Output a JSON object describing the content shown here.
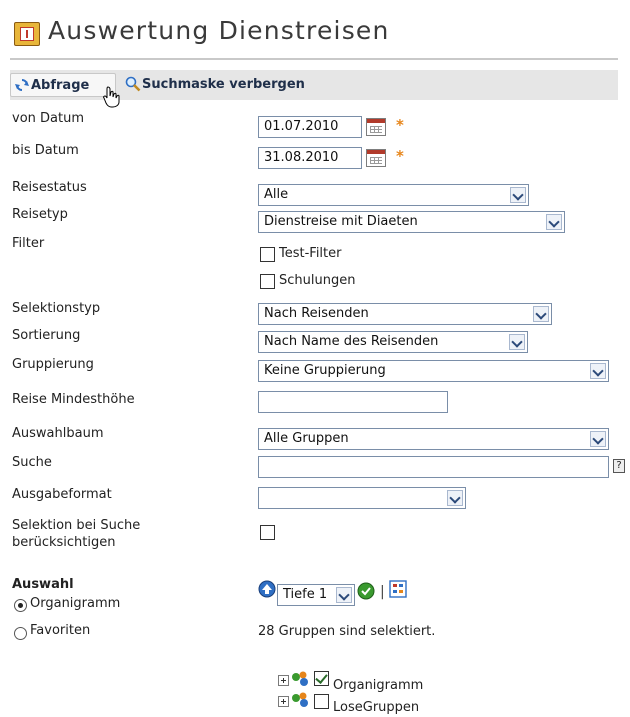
{
  "page": {
    "title": "Auswertung Dienstreisen"
  },
  "toolbar": {
    "query_label": "Abfrage",
    "hide_mask_label": "Suchmaske verbergen"
  },
  "form": {
    "from_date": {
      "label": "von Datum",
      "value": "01.07.2010"
    },
    "to_date": {
      "label": "bis Datum",
      "value": "31.08.2010"
    },
    "required_marker": "*",
    "travel_status": {
      "label": "Reisestatus",
      "value": "Alle"
    },
    "travel_type": {
      "label": "Reisetyp",
      "value": "Dienstreise mit Diaeten"
    },
    "filter": {
      "label": "Filter",
      "options": [
        {
          "label": "Test-Filter",
          "checked": false
        },
        {
          "label": "Schulungen",
          "checked": false
        }
      ]
    },
    "selection_type": {
      "label": "Selektionstyp",
      "value": "Nach Reisenden"
    },
    "sorting": {
      "label": "Sortierung",
      "value": "Nach Name des Reisenden"
    },
    "grouping": {
      "label": "Gruppierung",
      "value": "Keine Gruppierung"
    },
    "min_amount": {
      "label": "Reise Mindesthöhe",
      "value": ""
    },
    "selection_tree": {
      "label": "Auswahlbaum",
      "value": "Alle Gruppen"
    },
    "search": {
      "label": "Suche",
      "value": "",
      "help": "?"
    },
    "output_format": {
      "label": "Ausgabeformat",
      "value": ""
    },
    "consider_selection": {
      "label_line1": "Selektion bei Suche",
      "label_line2": "berücksichtigen",
      "checked": false
    }
  },
  "selection": {
    "heading": "Auswahl",
    "radio_options": [
      {
        "label": "Organigramm",
        "selected": true
      },
      {
        "label": "Favoriten",
        "selected": false
      }
    ],
    "depth_value": "Tiefe 1",
    "separator": "|",
    "status_text": "28 Gruppen sind selektiert.",
    "tree": [
      {
        "label": "Organigramm",
        "checked": true
      },
      {
        "label": "LoseGruppen",
        "checked": false
      }
    ]
  },
  "colors": {
    "required": "#e6851a",
    "toolbar_bg": "#e6e6e6",
    "title_text": "#3a3a3a",
    "input_border": "#7a8ea8"
  }
}
